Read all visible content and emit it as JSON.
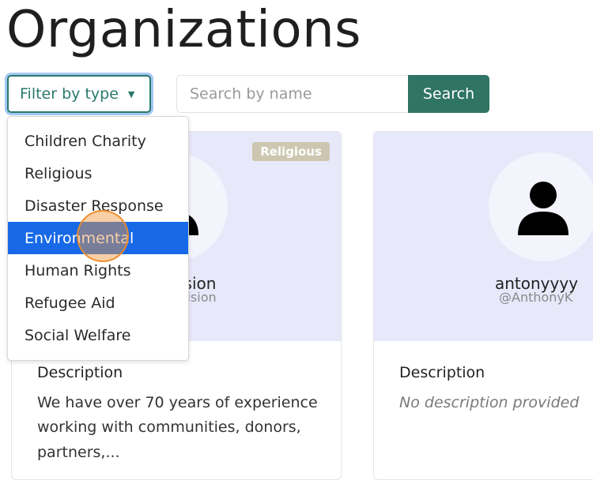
{
  "page": {
    "title": "Organizations"
  },
  "filter": {
    "label": "Filter by type",
    "caret_icon": "caret-down-icon"
  },
  "search": {
    "placeholder": "Search by name",
    "button_label": "Search"
  },
  "dropdown": {
    "items": [
      {
        "label": "Children Charity"
      },
      {
        "label": "Religious"
      },
      {
        "label": "Disaster Response"
      },
      {
        "label": "Environmental",
        "active": true
      },
      {
        "label": "Human Rights"
      },
      {
        "label": "Refugee Aid"
      },
      {
        "label": "Social Welfare"
      }
    ]
  },
  "cards": [
    {
      "badge": "Religious",
      "name": "ision",
      "handle": "vision",
      "description_label": "Description",
      "description": "We have over 70 years of experience working with communities, donors, partners,..."
    },
    {
      "name": "antonyyyy",
      "handle": "@AnthonyK",
      "description_label": "Description",
      "description": "No description provided"
    }
  ],
  "colors": {
    "accent": "#2f7465",
    "dropdown_active": "#1769e8",
    "card_header_bg": "#e7e9fb",
    "badge_bg": "#cdc6b0"
  }
}
